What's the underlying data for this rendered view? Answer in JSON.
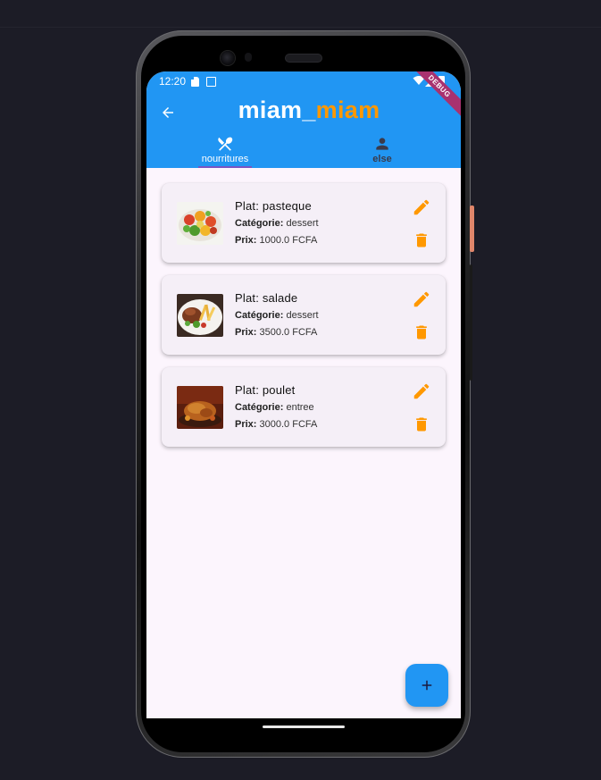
{
  "status_bar": {
    "time": "12:20",
    "debug_label": "DEBUG"
  },
  "app_bar": {
    "title_part1": "miam_",
    "title_part2": "miam"
  },
  "tabs": [
    {
      "label": "nourritures",
      "icon": "utensils-icon",
      "selected": true
    },
    {
      "label": "else",
      "icon": "person-icon",
      "selected": false
    }
  ],
  "labels": {
    "name_prefix": "Plat: ",
    "category_label": "Catégorie:",
    "price_label": "Prix:"
  },
  "dishes": [
    {
      "name": "pasteque",
      "category": "dessert",
      "price": "1000.0 FCFA",
      "image": "salad-bowl"
    },
    {
      "name": "salade",
      "category": "dessert",
      "price": "3500.0 FCFA",
      "image": "meat-fries-plate"
    },
    {
      "name": "poulet",
      "category": "entree",
      "price": "3000.0 FCFA",
      "image": "roast-chicken"
    }
  ],
  "fab": {
    "icon": "plus-icon"
  },
  "colors": {
    "primary": "#2196f3",
    "accent": "#ff9800",
    "indicator": "#7a55c2",
    "background": "#fcf5fd",
    "card": "#f5eff7"
  }
}
